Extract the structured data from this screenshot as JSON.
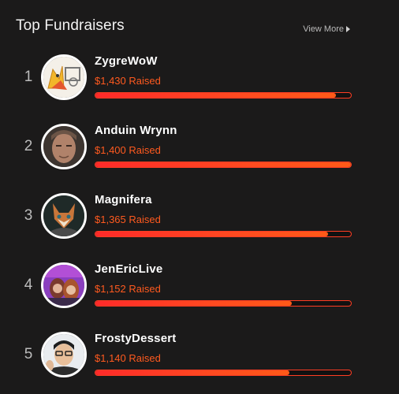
{
  "header": {
    "title": "Top Fundraisers",
    "view_more": "View More"
  },
  "fundraisers": [
    {
      "rank": "1",
      "name": "ZygreWoW",
      "raised": "$1,430 Raised",
      "progress": 0.94
    },
    {
      "rank": "2",
      "name": "Anduin Wrynn",
      "raised": "$1,400 Raised",
      "progress": 1.0
    },
    {
      "rank": "3",
      "name": "Magnifera",
      "raised": "$1,365 Raised",
      "progress": 0.91
    },
    {
      "rank": "4",
      "name": "JenEricLive",
      "raised": "$1,152 Raised",
      "progress": 0.77
    },
    {
      "rank": "5",
      "name": "FrostyDessert",
      "raised": "$1,140 Raised",
      "progress": 0.76
    }
  ],
  "colors": {
    "accent": "#ff5a1f",
    "bar": "#ff3d23",
    "background": "#1b1a1a"
  }
}
